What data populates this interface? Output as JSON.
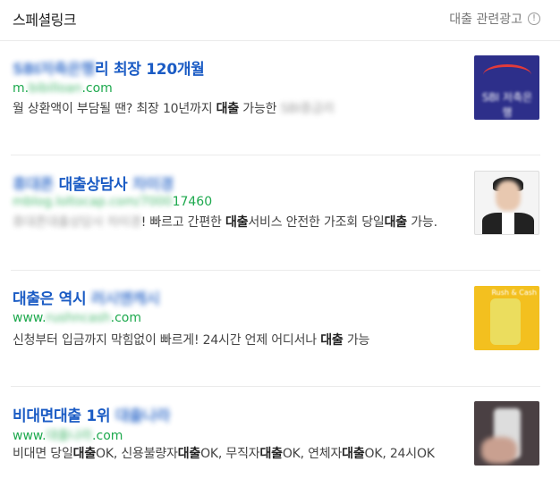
{
  "header": {
    "title": "스페셜링크",
    "right_label": "대출 관련광고",
    "info_icon_glyph": "!"
  },
  "ads": [
    {
      "title_blur": "SBI저축은행",
      "title": "리 최장 120개월",
      "url_prefix": "m.",
      "url_blur": "bibilloan",
      "url_suffix": ".com",
      "desc_plain": "월 상환액이 부담될 땐? 최장 10년까지 ",
      "desc_bold": "대출",
      "desc_plain2": " 가능한 ",
      "desc_blur": "SBI중금리",
      "thumb_label": "SBI 저축은행",
      "thumb_icon": "bank-logo-icon"
    },
    {
      "title_blur": "휴대폰",
      "title": "대출상담사 ",
      "title_blur2": "차미경",
      "url_blur": "mblog.loltocap.com/7000",
      "url_suffix": "17460",
      "desc_blur": "휴대폰대출상담사 차미경",
      "desc_plain": "! 빠르고 간편한 ",
      "desc_bold": "대출",
      "desc_plain2": "서비스 안전한 가조회 당일",
      "desc_bold2": "대출",
      "desc_plain3": " 가능.",
      "thumb_icon": "person-portrait-icon"
    },
    {
      "title": "대출은 역시 ",
      "title_blur": "러시앤캐시",
      "url_prefix": "www.",
      "url_blur": "rushncash",
      "url_suffix": ".com",
      "desc_plain": "신청부터 입금까지 막힘없이 빠르게! 24시간 언제 어디서나 ",
      "desc_bold": "대출",
      "desc_plain2": " 가능",
      "thumb_label": "Rush & Cash",
      "thumb_icon": "drink-ad-icon"
    },
    {
      "title": "비대면대출 1위 ",
      "title_blur": "대출나라",
      "url_prefix": "www.",
      "url_blur": "대출나라",
      "url_suffix": ".com",
      "desc_plain": "비대면 당일",
      "desc_bold": "대출",
      "desc_plain2": "OK, 신용불량자",
      "desc_bold2": "대출",
      "desc_plain3": "OK, 무직자",
      "desc_bold3": "대출",
      "desc_plain4": "OK, 연체자",
      "desc_bold4": "대출",
      "desc_plain5": "OK, 24시OK",
      "thumb_icon": "phone-in-hand-icon"
    }
  ]
}
